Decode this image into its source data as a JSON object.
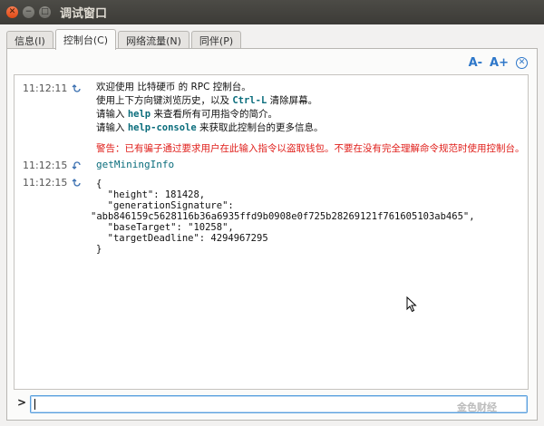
{
  "window": {
    "title": "调试窗口"
  },
  "tabs": [
    {
      "label": "信息(I)",
      "active": false
    },
    {
      "label": "控制台(C)",
      "active": true
    },
    {
      "label": "网络流量(N)",
      "active": false
    },
    {
      "label": "同伴(P)",
      "active": false
    }
  ],
  "font_controls": {
    "decrease": "A-",
    "increase": "A+"
  },
  "console": {
    "welcome": {
      "time": "11:12:11",
      "line1": "欢迎使用 比特硬币 的 RPC 控制台。",
      "line2_pre": "使用上下方向键浏览历史，以及 ",
      "line2_key": "Ctrl-L",
      "line2_post": " 清除屏幕。",
      "line3_pre": "请输入 ",
      "line3_cmd": "help",
      "line3_post": " 来查看所有可用指令的简介。",
      "line4_pre": "请输入 ",
      "line4_cmd": "help-console",
      "line4_post": " 来获取此控制台的更多信息。",
      "warning": "警告：已有骗子通过要求用户在此输入指令以盗取钱包。不要在没有完全理解命令规范时使用控制台。"
    },
    "command": {
      "time": "11:12:15",
      "text": "getMiningInfo"
    },
    "result": {
      "time": "11:12:15",
      "lines": [
        "{",
        "  \"height\": 181428,",
        "  \"generationSignature\":",
        "\"abb846159c5628116b36a6935ffd9b0908e0f725b28269121f761605103ab465\",",
        "  \"baseTarget\": \"10258\",",
        "  \"targetDeadline\": 4294967295",
        "}"
      ]
    }
  },
  "input": {
    "prompt": ">",
    "value": ""
  },
  "watermark": "金色财经"
}
